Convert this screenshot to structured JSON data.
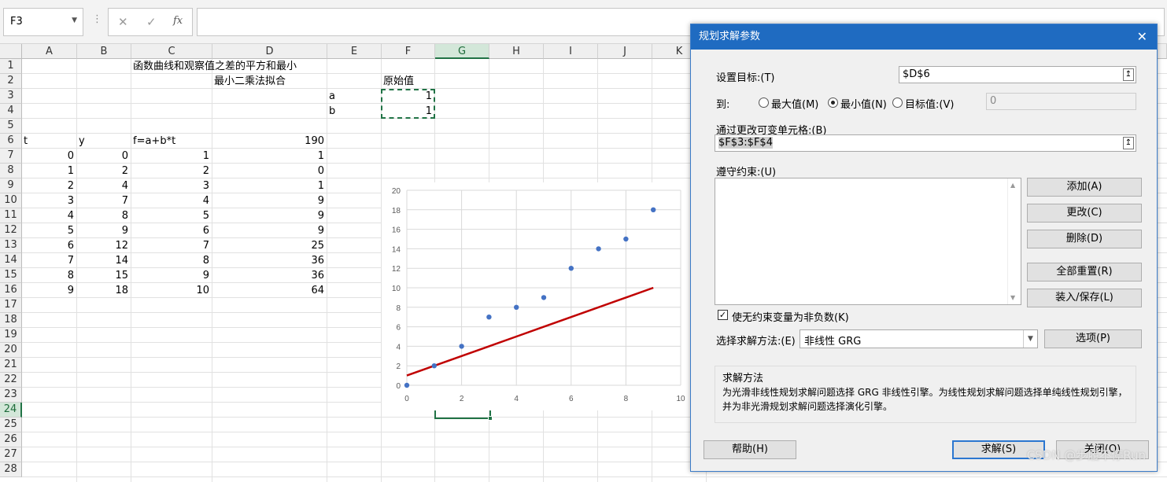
{
  "formula_bar": {
    "name_box": "F3",
    "cancel_icon": "✕",
    "enter_icon": "✓",
    "fx_icon": "fx",
    "formula": ""
  },
  "columns": [
    "A",
    "B",
    "C",
    "D",
    "E",
    "F",
    "G",
    "H",
    "I",
    "J",
    "K"
  ],
  "rows": [
    "1",
    "2",
    "3",
    "4",
    "5",
    "6",
    "7",
    "8",
    "9",
    "10",
    "11",
    "12",
    "13",
    "14",
    "15",
    "16",
    "17",
    "18",
    "19",
    "20",
    "21",
    "22",
    "23",
    "24",
    "25",
    "26",
    "27",
    "28"
  ],
  "cells": {
    "C1": "函数曲线和观察值之差的平方和最小",
    "D2": "最小二乘法拟合",
    "F2": "原始值",
    "E3": "a",
    "F3": "1",
    "E4": "b",
    "F4": "1",
    "A6": "t",
    "B6": "y",
    "C6": "f=a+b*t",
    "D6": "190"
  },
  "table": {
    "t": [
      "0",
      "1",
      "2",
      "3",
      "4",
      "5",
      "6",
      "7",
      "8",
      "9"
    ],
    "y": [
      "0",
      "2",
      "4",
      "7",
      "8",
      "9",
      "12",
      "14",
      "15",
      "18"
    ],
    "f": [
      "1",
      "2",
      "3",
      "4",
      "5",
      "6",
      "7",
      "8",
      "9",
      "10"
    ],
    "d": [
      "1",
      "0",
      "1",
      "9",
      "9",
      "9",
      "25",
      "36",
      "36",
      "64"
    ]
  },
  "chart_data": {
    "type": "scatter",
    "title": "",
    "xlabel": "",
    "ylabel": "",
    "xlim": [
      0,
      10
    ],
    "ylim": [
      0,
      20
    ],
    "x_ticks": [
      "0",
      "2",
      "4",
      "6",
      "8",
      "10"
    ],
    "y_ticks": [
      "0",
      "2",
      "4",
      "6",
      "8",
      "10",
      "12",
      "14",
      "16",
      "18",
      "20"
    ],
    "grid": true,
    "series": [
      {
        "type": "scatter",
        "color": "#4472c4",
        "x": [
          0,
          1,
          2,
          3,
          4,
          5,
          6,
          7,
          8,
          9
        ],
        "y": [
          0,
          2,
          4,
          7,
          8,
          9,
          12,
          14,
          15,
          18
        ]
      },
      {
        "type": "line",
        "color": "#c00000",
        "x": [
          0,
          1,
          2,
          3,
          4,
          5,
          6,
          7,
          8,
          9
        ],
        "y": [
          1,
          2,
          3,
          4,
          5,
          6,
          7,
          8,
          9,
          10
        ]
      }
    ]
  },
  "dialog": {
    "title": "规划求解参数",
    "close": "✕",
    "objective_label": "设置目标:(T)",
    "objective_value": "$D$6",
    "to_label": "到:",
    "opt_max": "最大值(M)",
    "opt_min": "最小值(N)",
    "opt_value": "目标值:(V)",
    "target_value": "0",
    "changing_label": "通过更改可变单元格:(B)",
    "changing_value": "$F$3:$F$4",
    "constraints_label": "遵守约束:(U)",
    "btn_add": "添加(A)",
    "btn_change": "更改(C)",
    "btn_delete": "删除(D)",
    "btn_reset": "全部重置(R)",
    "btn_load": "装入/保存(L)",
    "nonneg_label": "使无约束变量为非负数(K)",
    "method_label": "选择求解方法:(E)",
    "method_value": "非线性 GRG",
    "btn_options": "选项(P)",
    "group_title": "求解方法",
    "group_text1": "为光滑非线性规划求解问题选择 GRG 非线性引擎。为线性规划求解问题选择单纯线性规划引擎，",
    "group_text2": "并为非光滑规划求解问题选择演化引擎。",
    "btn_help": "帮助(H)",
    "btn_solve": "求解(S)",
    "btn_close": "关闭(O)",
    "ref_icon": "↥"
  },
  "watermark": "CSDN @步履不停Run"
}
